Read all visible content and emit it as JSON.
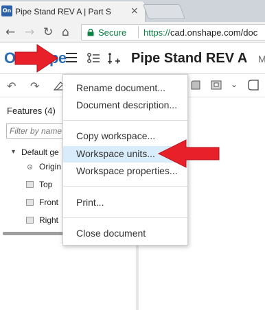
{
  "browser": {
    "tab": {
      "favicon_text": "On",
      "title": "Pipe Stand REV A | Part S",
      "close_glyph": "×"
    },
    "nav": {
      "back_glyph": "←",
      "forward_glyph": "→",
      "reload_glyph": "↻",
      "home_glyph": "⌂"
    },
    "address": {
      "secure_label": "Secure",
      "scheme": "https://",
      "host": "cad.onshape.com/doc"
    }
  },
  "app": {
    "logo_text": "Onshape",
    "document_title": "Pipe Stand REV A",
    "document_title_extra": "M",
    "brand_color": "#2c6db2"
  },
  "toolbar": {
    "undo_glyph": "↶",
    "redo_glyph": "↷",
    "dropdown_glyph": "⌄"
  },
  "feature_panel": {
    "heading": "Features (4)",
    "filter_placeholder": "Filter by name",
    "tree": {
      "group_caret": "▾",
      "group_label": "Default ge",
      "items": [
        {
          "label": "Origin",
          "icon": "origin-icon"
        },
        {
          "label": "Top",
          "icon": "plane-icon"
        },
        {
          "label": "Front",
          "icon": "plane-icon"
        },
        {
          "label": "Right",
          "icon": "plane-icon"
        }
      ]
    }
  },
  "menu": {
    "items": [
      {
        "label": "Rename document..."
      },
      {
        "label": "Document description..."
      },
      {
        "label": "Copy workspace..."
      },
      {
        "label": "Workspace units...",
        "highlighted": true
      },
      {
        "label": "Workspace properties..."
      },
      {
        "label": "Print..."
      },
      {
        "label": "Close document"
      }
    ],
    "highlight_color": "#d9ecfb"
  },
  "annotations": {
    "arrow_color": "#e8202a"
  }
}
